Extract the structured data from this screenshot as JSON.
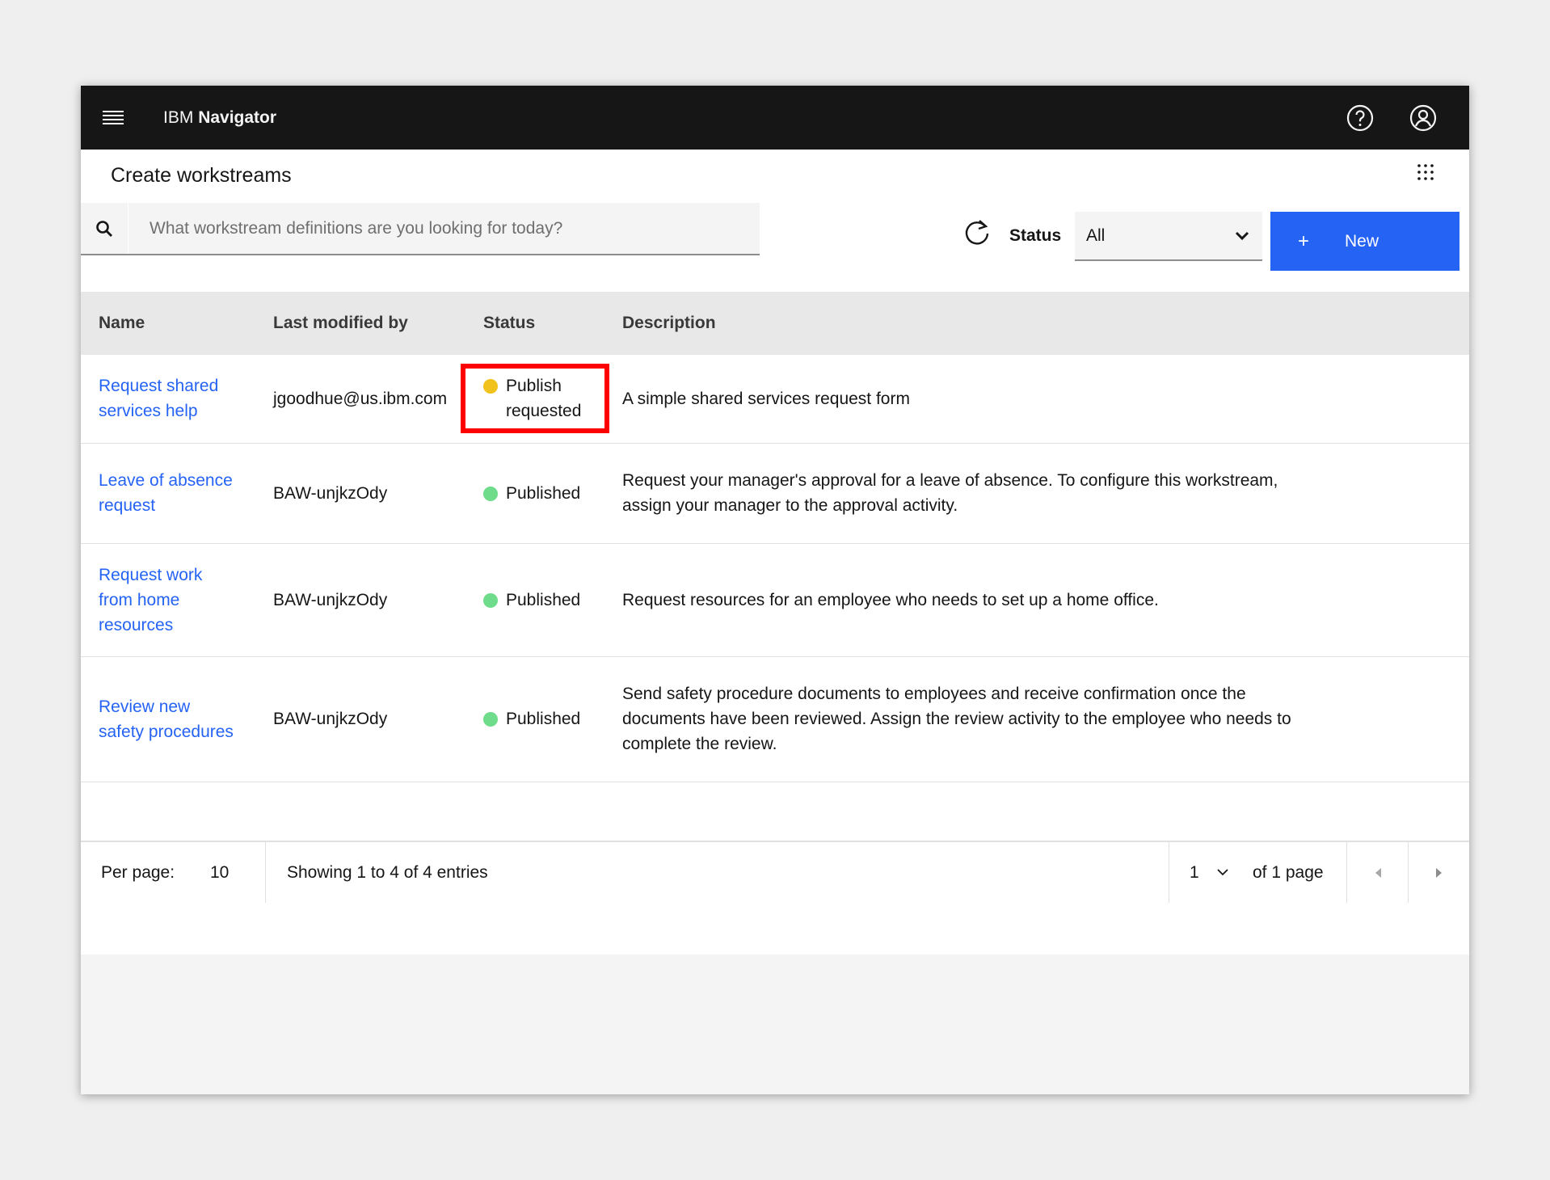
{
  "header": {
    "brand_prefix": "IBM",
    "brand_name": "Navigator"
  },
  "page": {
    "title": "Create workstreams"
  },
  "toolbar": {
    "search_placeholder": "What workstream definitions are you looking for today?",
    "status_label": "Status",
    "status_value": "All",
    "new_plus": "+",
    "new_label": "New"
  },
  "table": {
    "columns": [
      "Name",
      "Last modified by",
      "Status",
      "Description"
    ],
    "rows": [
      {
        "name_lines": [
          "Request shared",
          "services help"
        ],
        "modified_by": "jgoodhue@us.ibm.com",
        "status_lines": [
          "Publish",
          "requested"
        ],
        "status_color": "#f1c21b",
        "description_lines": [
          "A simple shared services request form"
        ]
      },
      {
        "name_lines": [
          "Leave of absence",
          "request"
        ],
        "modified_by": "BAW-unjkzOdy",
        "status_lines": [
          "Published"
        ],
        "status_color": "#6fdc8c",
        "description_lines": [
          "Request your manager's approval for a leave of absence. To configure this workstream,",
          "assign your manager to the approval activity."
        ]
      },
      {
        "name_lines": [
          "Request work",
          "from home",
          "resources"
        ],
        "modified_by": "BAW-unjkzOdy",
        "status_lines": [
          "Published"
        ],
        "status_color": "#6fdc8c",
        "description_lines": [
          "Request resources for an employee who needs to set up a home office."
        ]
      },
      {
        "name_lines": [
          "Review new",
          "safety procedures"
        ],
        "modified_by": "BAW-unjkzOdy",
        "status_lines": [
          "Published"
        ],
        "status_color": "#6fdc8c",
        "description_lines": [
          "Send safety procedure documents to employees and receive confirmation once the",
          "documents have been reviewed. Assign the review activity to the employee who needs to",
          "complete the review."
        ]
      }
    ]
  },
  "pagination": {
    "per_page_label": "Per page:",
    "per_page_value": "10",
    "showing": "Showing 1 to 4 of 4 entries",
    "current_page": "1",
    "of_pages": "of 1 page"
  },
  "colors": {
    "accent": "#2563f5",
    "header_bg": "#161616",
    "highlight": "#ff0000"
  }
}
